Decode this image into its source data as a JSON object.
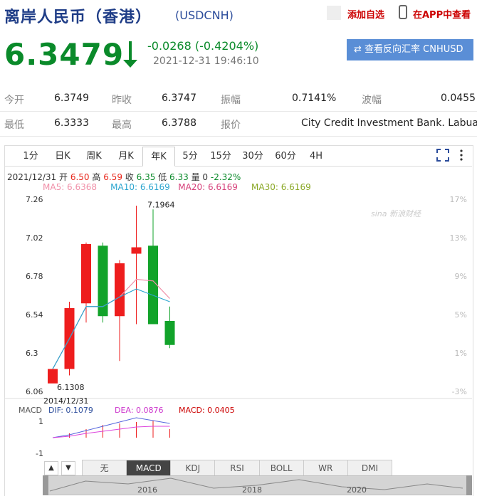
{
  "header": {
    "title": "离岸人民币（香港）",
    "code": "(USDCNH)",
    "add_fav": "添加自选",
    "app_link": "在APP中查看"
  },
  "quote": {
    "price": "6.3479",
    "change": "-0.0268 (-0.4204%)",
    "time": "2021-12-31 19:46:10",
    "reverse_button": "查看反向汇率 CNHUSD",
    "down_color": "#0a8a2a"
  },
  "stats": {
    "open_label": "今开",
    "open": "6.3749",
    "prev_close_label": "昨收",
    "prev_close": "6.3747",
    "amplitude_label": "振幅",
    "amplitude": "0.7141%",
    "bid_label": "波幅",
    "bid": "0.0455",
    "low_label": "最低",
    "low": "6.3333",
    "high_label": "最高",
    "high": "6.3788",
    "quote_label": "报价",
    "quote_src": "City Credit Investment Bank. Labuan"
  },
  "period_tabs": [
    "1分",
    "日K",
    "周K",
    "月K",
    "年K",
    "5分",
    "15分",
    "30分",
    "60分",
    "4H"
  ],
  "active_period": "年K",
  "info_line": {
    "date": "2021/12/31",
    "open_lbl": "开",
    "open": "6.50",
    "high_lbl": "高",
    "high": "6.59",
    "close_lbl": "收",
    "close": "6.35",
    "low_lbl": "低",
    "low": "6.33",
    "vol_lbl": "量",
    "vol": "0",
    "pct": "-2.32%"
  },
  "ma_line": {
    "ma5": "MA5: 6.6368",
    "ma10": "MA10: 6.6169",
    "ma20": "MA20: 6.6169",
    "ma30": "MA30: 6.6169"
  },
  "chart_data": {
    "type": "candlestick",
    "y_ticks": [
      "7.26",
      "7.02",
      "6.78",
      "6.54",
      "6.3",
      "6.06"
    ],
    "pct_ticks": [
      "17%",
      "13%",
      "9%",
      "5%",
      "1%",
      "-3%"
    ],
    "ylim": [
      6.06,
      7.26
    ],
    "candles": [
      {
        "o": 6.11,
        "c": 6.2,
        "h": 6.2,
        "l": 6.1308,
        "color": "red"
      },
      {
        "o": 6.2,
        "c": 6.58,
        "h": 6.62,
        "l": 6.16,
        "color": "red"
      },
      {
        "o": 6.61,
        "c": 6.98,
        "h": 6.99,
        "l": 6.49,
        "color": "red"
      },
      {
        "o": 6.97,
        "c": 6.53,
        "h": 6.99,
        "l": 6.49,
        "color": "green"
      },
      {
        "o": 6.53,
        "c": 6.86,
        "h": 6.88,
        "l": 6.25,
        "color": "red"
      },
      {
        "o": 6.92,
        "c": 6.96,
        "h": 7.22,
        "l": 6.48,
        "color": "red"
      },
      {
        "o": 6.97,
        "c": 6.48,
        "h": 7.1964,
        "l": 6.48,
        "color": "green"
      },
      {
        "o": 6.5,
        "c": 6.35,
        "h": 6.59,
        "l": 6.33,
        "color": "green"
      }
    ],
    "ma5": [
      6.2,
      6.39,
      6.59,
      6.59,
      6.65,
      6.76,
      6.75,
      6.64
    ],
    "ma10": [
      6.2,
      6.39,
      6.59,
      6.59,
      6.65,
      6.7,
      6.66,
      6.62
    ],
    "max_label": "7.1964",
    "min_label": "6.1308",
    "start_date": "2014/12/31",
    "watermark": "sina 新浪财经"
  },
  "macd": {
    "label": "MACD",
    "dif": "DIF: 0.1079",
    "dea": "DEA: 0.0876",
    "macd": "MACD: 0.0405",
    "ticks": [
      "1",
      "-1"
    ]
  },
  "indicator_tabs": [
    "无",
    "MACD",
    "KDJ",
    "RSI",
    "BOLL",
    "WR",
    "DMI"
  ],
  "active_indicator": "MACD",
  "timeline_years": [
    "2016",
    "2018",
    "2020"
  ]
}
